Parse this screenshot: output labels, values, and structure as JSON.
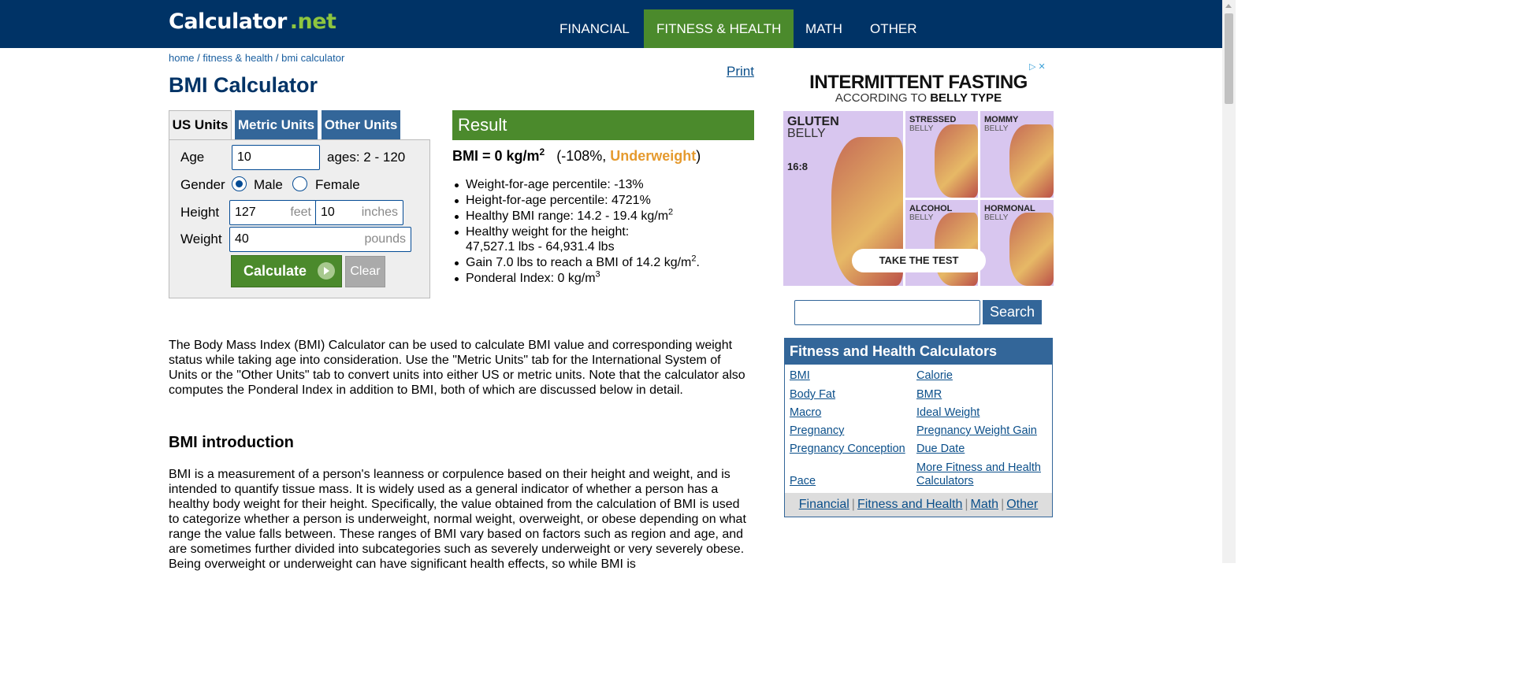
{
  "header": {
    "logo_main": "Calculator",
    "logo_dot_net": ".net",
    "nav": [
      "FINANCIAL",
      "FITNESS & HEALTH",
      "MATH",
      "OTHER"
    ]
  },
  "breadcrumb": {
    "home": "home",
    "sep": " / ",
    "fitness": "fitness & health",
    "current": "bmi calculator"
  },
  "print": "Print",
  "title": "BMI Calculator",
  "tabs": [
    "US Units",
    "Metric Units",
    "Other Units"
  ],
  "form": {
    "age_label": "Age",
    "age_value": "10",
    "age_hint": "ages: 2 - 120",
    "gender_label": "Gender",
    "male": "Male",
    "female": "Female",
    "height_label": "Height",
    "height_feet": "127",
    "feet_unit": "feet",
    "height_inches": "10",
    "inches_unit": "inches",
    "weight_label": "Weight",
    "weight_value": "40",
    "weight_unit": "pounds",
    "calculate": "Calculate",
    "clear": "Clear"
  },
  "result": {
    "heading": "Result",
    "bmi_text": "BMI = 0 kg/m",
    "bmi_sup": "2",
    "paren_open": "(-108%, ",
    "status": "Underweight",
    "paren_close": ")",
    "items": {
      "weight_pct": "Weight-for-age percentile: -13%",
      "height_pct": "Height-for-age percentile: 4721%",
      "healthy_range": "Healthy BMI range: 14.2 - 19.4 kg/m",
      "healthy_weight_1": "Healthy weight for the height:",
      "healthy_weight_2": "47,527.1 lbs - 64,931.4 lbs",
      "gain": "Gain 7.0 lbs to reach a BMI of 14.2 kg/m",
      "ponderal": "Ponderal Index: 0 kg/m"
    },
    "sup2": "2",
    "sup3": "3",
    "period": "."
  },
  "content": {
    "para1": "The Body Mass Index (BMI) Calculator can be used to calculate BMI value and corresponding weight status while taking age into consideration. Use the \"Metric Units\" tab for the International System of Units or the \"Other Units\" tab to convert units into either US or metric units. Note that the calculator also computes the Ponderal Index in addition to BMI, both of which are discussed below in detail.",
    "intro_heading": "BMI introduction",
    "para2": "BMI is a measurement of a person's leanness or corpulence based on their height and weight, and is intended to quantify tissue mass. It is widely used as a general indicator of whether a person has a healthy body weight for their height. Specifically, the value obtained from the calculation of BMI is used to categorize whether a person is underweight, normal weight, overweight, or obese depending on what range the value falls between. These ranges of BMI vary based on factors such as region and age, and are sometimes further divided into subcategories such as severely underweight or very severely obese. Being overweight or underweight can have significant health effects, so while BMI is"
  },
  "ad": {
    "title": "INTERMITTENT FASTING",
    "sub_prefix": "ACCORDING TO ",
    "sub_bold": "BELLY TYPE",
    "close_glyphs": "▷ ✕",
    "cells": {
      "gluten_h": "GLUTEN",
      "gluten_s": "BELLY",
      "gluten_time": "16:8",
      "stressed_h": "STRESSED",
      "stressed_s": "BELLY",
      "mommy_h": "MOMMY",
      "mommy_s": "BELLY",
      "alcohol_h": "ALCOHOL",
      "alcohol_s": "BELLY",
      "hormonal_h": "HORMONAL",
      "hormonal_s": "BELLY"
    },
    "cta": "TAKE THE TEST"
  },
  "search": {
    "button": "Search"
  },
  "side": {
    "heading": "Fitness and Health Calculators",
    "links_left": [
      "BMI",
      "Body Fat",
      "Macro",
      "Pregnancy",
      "Pregnancy Conception",
      "Pace"
    ],
    "links_right": [
      "Calorie",
      "BMR",
      "Ideal Weight",
      "Pregnancy Weight Gain",
      "Due Date",
      "More Fitness and Health",
      "Calculators"
    ],
    "footer": [
      "Financial",
      "Fitness and Health",
      "Math",
      "Other"
    ],
    "footer_sep": "|"
  },
  "colors": {
    "navy": "#003366",
    "green": "#4b8a2c",
    "blue": "#336699",
    "orange": "#e59a2e"
  }
}
